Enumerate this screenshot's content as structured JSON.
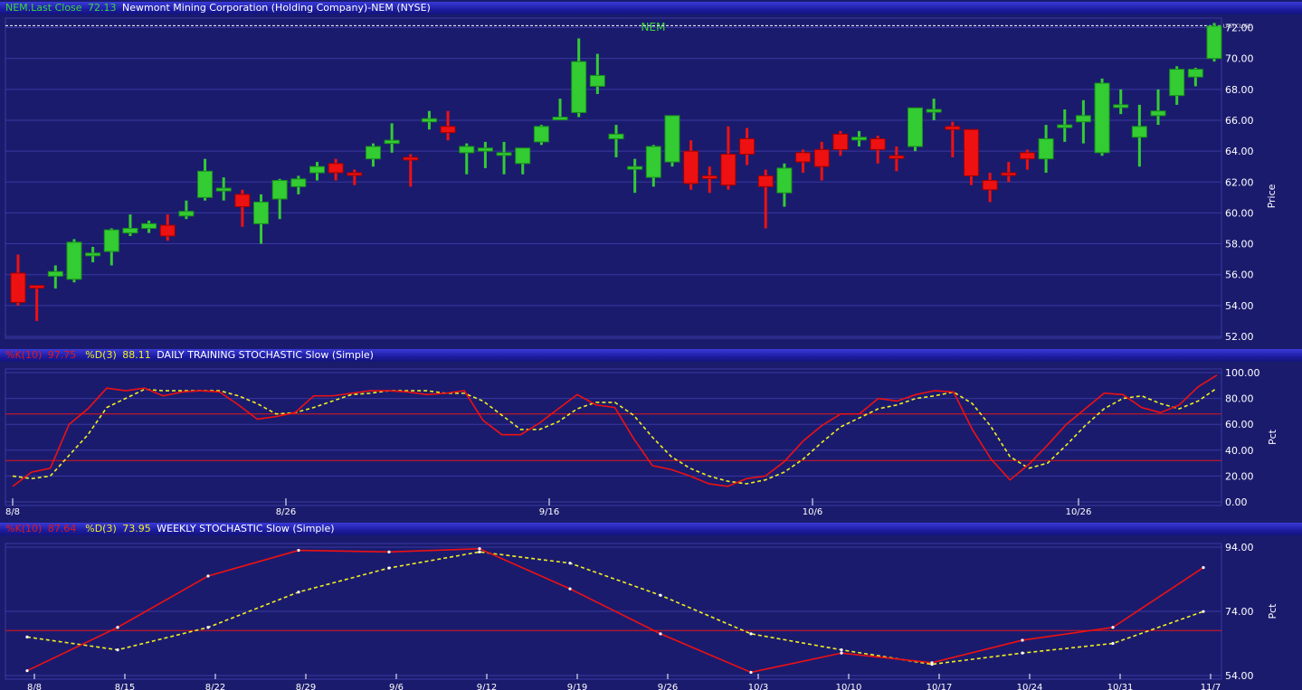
{
  "header": {
    "symbol_label": "NEM.Last Close",
    "last_close": "72.13",
    "company": "Newmont Mining Corporation (Holding Company)-NEM (NYSE)"
  },
  "price_panel": {
    "title": "NEM",
    "ylabel": "Price",
    "last_close_tag": "LAST CLOSE",
    "y_ticks": [
      "52.00",
      "54.00",
      "56.00",
      "58.00",
      "60.00",
      "62.00",
      "64.00",
      "66.00",
      "68.00",
      "70.00",
      "72.00"
    ]
  },
  "daily_panel": {
    "k_label": "%K(10)",
    "k_value": "97.75",
    "d_label": "%D(3)",
    "d_value": "88.11",
    "title": "DAILY TRAINING STOCHASTIC Slow (Simple)",
    "ylabel": "Pct",
    "y_ticks": [
      "0.00",
      "20.00",
      "40.00",
      "60.00",
      "80.00",
      "100.00"
    ],
    "x_ticks": [
      "8/8",
      "8/26",
      "9/16",
      "10/6",
      "10/26"
    ]
  },
  "weekly_panel": {
    "k_label": "%K(10)",
    "k_value": "87.64",
    "d_label": "%D(3)",
    "d_value": "73.95",
    "title": "WEEKLY STOCHASTIC Slow (Simple)",
    "ylabel": "Pct",
    "y_ticks": [
      "54.00",
      "74.00",
      "94.00"
    ],
    "x_ticks": [
      "8/8",
      "8/15",
      "8/22",
      "8/29",
      "9/6",
      "9/12",
      "9/19",
      "9/26",
      "10/3",
      "10/10",
      "10/17",
      "10/24",
      "10/31",
      "11/7"
    ]
  },
  "colors": {
    "background": "#1b1b6e",
    "up": "#33cc33",
    "down": "#ee1111",
    "k_line": "#ee1111",
    "d_line": "#f0f020",
    "grid": "#3838a0"
  },
  "chart_data": [
    {
      "type": "candlestick",
      "title": "NEM",
      "ylabel": "Price",
      "ylim": [
        52,
        72.5
      ],
      "ohlc": [
        [
          56.1,
          57.3,
          54.0,
          54.2
        ],
        [
          55.3,
          55.3,
          53.0,
          55.2
        ],
        [
          55.9,
          56.6,
          55.1,
          56.2
        ],
        [
          55.7,
          58.3,
          55.5,
          58.1
        ],
        [
          57.3,
          57.8,
          56.8,
          57.4
        ],
        [
          57.5,
          59.0,
          56.6,
          58.9
        ],
        [
          58.7,
          59.9,
          58.5,
          59.0
        ],
        [
          59.0,
          59.5,
          58.7,
          59.3
        ],
        [
          59.2,
          59.9,
          58.2,
          58.5
        ],
        [
          59.8,
          60.8,
          59.6,
          60.1
        ],
        [
          61.0,
          63.5,
          60.8,
          62.7
        ],
        [
          61.5,
          62.3,
          60.8,
          61.6
        ],
        [
          61.2,
          61.5,
          59.1,
          60.4
        ],
        [
          59.3,
          61.2,
          58.0,
          60.7
        ],
        [
          60.9,
          62.2,
          59.6,
          62.1
        ],
        [
          61.7,
          62.4,
          61.2,
          62.2
        ],
        [
          62.6,
          63.3,
          62.1,
          63.0
        ],
        [
          63.2,
          63.5,
          62.1,
          62.6
        ],
        [
          62.6,
          62.8,
          61.8,
          62.5
        ],
        [
          63.5,
          64.5,
          63.0,
          64.3
        ],
        [
          64.5,
          65.8,
          63.9,
          64.7
        ],
        [
          63.6,
          63.8,
          61.7,
          63.5
        ],
        [
          65.9,
          66.6,
          65.4,
          66.1
        ],
        [
          65.6,
          66.6,
          64.7,
          65.2
        ],
        [
          63.9,
          64.5,
          62.5,
          64.3
        ],
        [
          64.0,
          64.6,
          62.9,
          64.2
        ],
        [
          63.9,
          64.6,
          62.5,
          63.9
        ],
        [
          63.2,
          64.2,
          62.5,
          64.2
        ],
        [
          64.6,
          65.7,
          64.4,
          65.6
        ],
        [
          66.2,
          67.4,
          66.0,
          66.2
        ],
        [
          66.5,
          71.3,
          66.2,
          69.8
        ],
        [
          68.2,
          70.3,
          67.7,
          68.9
        ],
        [
          64.8,
          65.7,
          63.6,
          65.1
        ],
        [
          63.0,
          63.5,
          61.3,
          63.0
        ],
        [
          62.3,
          64.4,
          61.7,
          64.3
        ],
        [
          63.3,
          66.3,
          63.0,
          66.3
        ],
        [
          64.0,
          64.7,
          61.5,
          61.9
        ],
        [
          62.4,
          63.0,
          61.3,
          62.3
        ],
        [
          63.8,
          65.6,
          61.5,
          61.8
        ],
        [
          64.8,
          65.5,
          63.1,
          63.8
        ],
        [
          62.4,
          62.8,
          59.0,
          61.7
        ],
        [
          61.3,
          63.2,
          60.4,
          62.9
        ],
        [
          63.9,
          64.1,
          62.6,
          63.3
        ],
        [
          64.1,
          64.6,
          62.1,
          63.0
        ],
        [
          65.1,
          65.3,
          63.7,
          64.1
        ],
        [
          64.9,
          65.3,
          64.3,
          64.9
        ],
        [
          64.8,
          65.0,
          63.2,
          64.1
        ],
        [
          63.7,
          64.3,
          62.7,
          63.6
        ],
        [
          64.3,
          66.8,
          64.0,
          66.8
        ],
        [
          66.7,
          67.4,
          66.0,
          66.7
        ],
        [
          65.6,
          65.9,
          63.6,
          65.4
        ],
        [
          65.4,
          65.4,
          61.8,
          62.4
        ],
        [
          62.1,
          62.6,
          60.7,
          61.5
        ],
        [
          62.6,
          63.3,
          62.0,
          62.5
        ],
        [
          63.9,
          64.1,
          62.8,
          63.5
        ],
        [
          63.5,
          65.7,
          62.6,
          64.8
        ],
        [
          65.7,
          66.7,
          64.6,
          65.7
        ],
        [
          65.9,
          67.3,
          64.5,
          66.3
        ],
        [
          63.9,
          68.7,
          63.7,
          68.4
        ],
        [
          66.9,
          68.0,
          66.4,
          67.0
        ],
        [
          64.9,
          67.0,
          63.0,
          65.6
        ],
        [
          66.3,
          68.0,
          65.7,
          66.6
        ],
        [
          67.6,
          69.5,
          67.0,
          69.3
        ],
        [
          68.8,
          69.4,
          68.2,
          69.3
        ],
        [
          70.0,
          72.3,
          69.8,
          72.1
        ]
      ]
    },
    {
      "type": "line",
      "title": "DAILY TRAINING STOCHASTIC Slow (Simple)",
      "ylabel": "Pct",
      "ylim": [
        0,
        100
      ],
      "x_tick_labels": [
        "8/8",
        "8/26",
        "9/16",
        "10/6",
        "10/26"
      ],
      "reference_lines": [
        68,
        32
      ],
      "series": [
        {
          "name": "%K(10)",
          "values": [
            12,
            23,
            26,
            60,
            72,
            88,
            86,
            88,
            82,
            85,
            86,
            85,
            75,
            64,
            66,
            69,
            82,
            82,
            84,
            86,
            86,
            85,
            83,
            84,
            86,
            63,
            52,
            52,
            61,
            72,
            83,
            75,
            73,
            49,
            28,
            25,
            20,
            14,
            12,
            18,
            20,
            31,
            47,
            59,
            68,
            68,
            80,
            78,
            83,
            86,
            85,
            56,
            33,
            17,
            29,
            44,
            60,
            72,
            84,
            83,
            73,
            69,
            75,
            89,
            98
          ]
        },
        {
          "name": "%D(3)",
          "values": [
            20,
            18,
            20,
            36,
            52,
            73,
            80,
            87,
            86,
            86,
            86,
            86,
            82,
            76,
            68,
            69,
            73,
            78,
            83,
            84,
            86,
            86,
            86,
            84,
            84,
            78,
            67,
            56,
            56,
            62,
            72,
            77,
            77,
            67,
            50,
            35,
            26,
            20,
            16,
            14,
            17,
            23,
            33,
            46,
            58,
            65,
            72,
            75,
            80,
            82,
            85,
            76,
            58,
            35,
            26,
            30,
            44,
            59,
            72,
            80,
            82,
            76,
            72,
            78,
            88
          ]
        }
      ]
    },
    {
      "type": "line",
      "title": "WEEKLY STOCHASTIC Slow (Simple)",
      "ylabel": "Pct",
      "ylim": [
        54,
        94
      ],
      "categories": [
        "8/8",
        "8/15",
        "8/22",
        "8/29",
        "9/6",
        "9/12",
        "9/19",
        "9/26",
        "10/3",
        "10/10",
        "10/17",
        "10/24",
        "10/31",
        "11/7"
      ],
      "reference_lines": [
        68
      ],
      "series": [
        {
          "name": "%K(10)",
          "values": [
            55.5,
            69,
            85,
            93,
            92.5,
            93.5,
            81,
            67,
            55,
            61,
            58,
            65,
            69,
            87.64
          ]
        },
        {
          "name": "%D(3)",
          "values": [
            66,
            62,
            69,
            80,
            87.5,
            92.5,
            89,
            79,
            67,
            62,
            57.5,
            61,
            64,
            73.95
          ]
        }
      ]
    }
  ]
}
